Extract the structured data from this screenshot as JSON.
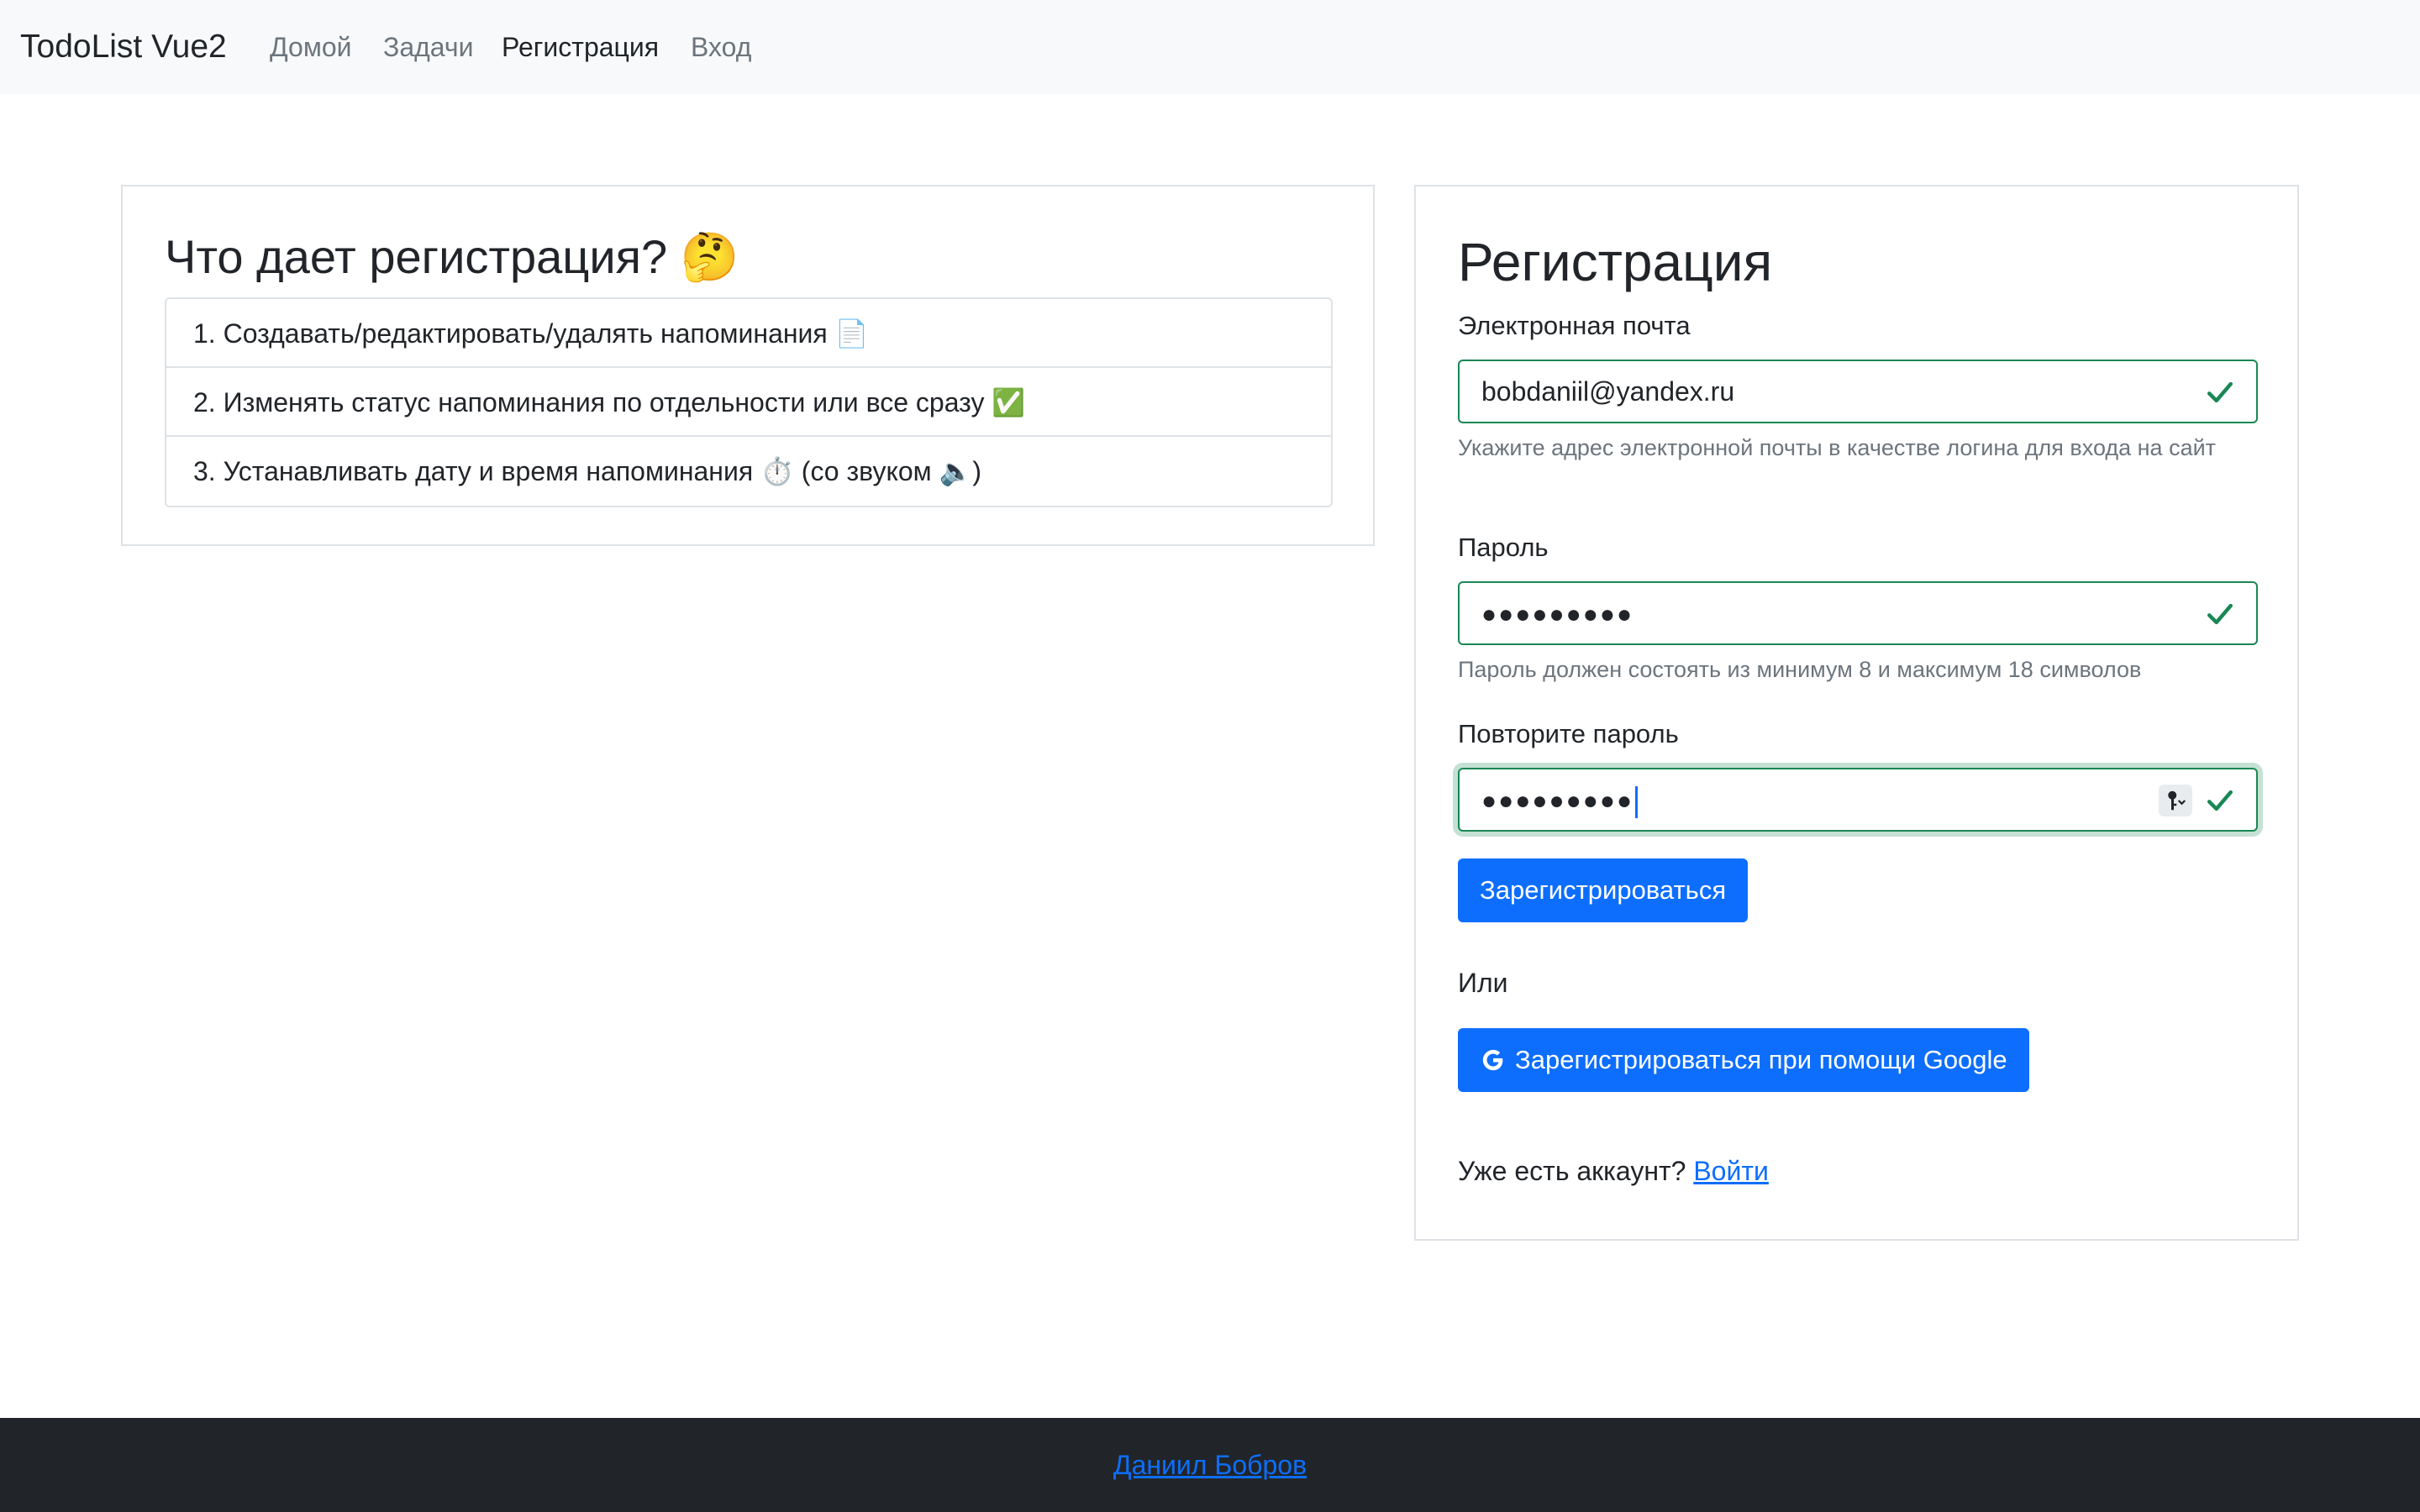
{
  "navbar": {
    "brand": "TodoList Vue2",
    "links": [
      "Домой",
      "Задачи",
      "Регистрация",
      "Вход"
    ],
    "active": "Регистрация"
  },
  "benefits": {
    "title": "Что дает регистрация? 🤔",
    "items": [
      "1. Создавать/редактировать/удалять напоминания 📄",
      "2. Изменять статус напоминания по отдельности или все сразу ✅",
      "3. Устанавливать дату и время напоминания ⏱️ (со звуком 🔈)"
    ]
  },
  "form": {
    "title": "Регистрация",
    "email": {
      "label": "Электронная почта",
      "value": "bobdaniil@yandex.ru",
      "help": "Укажите адрес электронной почты в качестве логина для входа на сайт"
    },
    "password": {
      "label": "Пароль",
      "value": "●●●●●●●●●",
      "help": "Пароль должен состоять из минимум 8 и максимум 18 символов"
    },
    "confirm_password": {
      "label": "Повторите пароль",
      "value": "●●●●●●●●●"
    },
    "submit_label": "Зарегистрироваться",
    "or_text": "Или",
    "google_label": "Зарегистрироваться при помощи Google",
    "account_prompt": "Уже есть аккаунт?",
    "login_link": "Войти"
  },
  "footer": {
    "author": "Даниил Бобров"
  },
  "colors": {
    "primary": "#0d6efd",
    "valid": "#198754",
    "navbar_bg": "#f8f9fa",
    "footer_bg": "#212529"
  },
  "icons": [
    "check-icon",
    "key-icon",
    "google-icon"
  ]
}
